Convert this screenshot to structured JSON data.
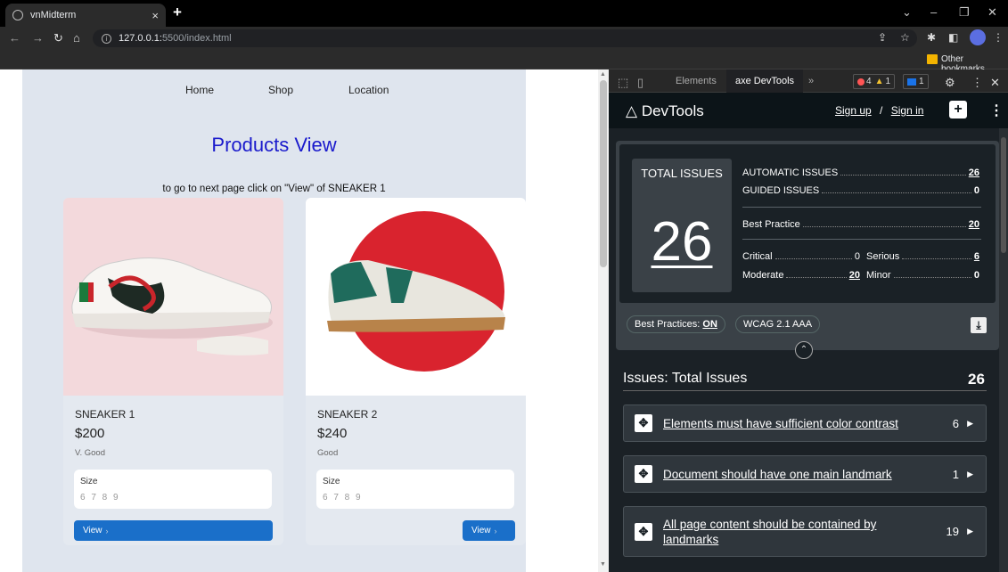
{
  "browser": {
    "tab_title": "vnMidterm",
    "tab_close": "×",
    "new_tab": "+",
    "url_host": "127.0.0.1:",
    "url_path": "5500/index.html",
    "bookmarks_other": "Other bookmarks"
  },
  "page": {
    "nav": [
      "Home",
      "Shop",
      "Location"
    ],
    "title": "Products View",
    "hint": "to go to next page click on \"View\" of SNEAKER 1",
    "products": [
      {
        "name": "SNEAKER 1",
        "price": "$200",
        "condition": "V. Good",
        "size_label": "Size",
        "sizes": "6 7 8 9",
        "button": "View"
      },
      {
        "name": "SNEAKER 2",
        "price": "$240",
        "condition": "Good",
        "size_label": "Size",
        "sizes": "6 7 8 9",
        "button": "View"
      }
    ]
  },
  "devtools": {
    "tabs": {
      "elements": "Elements",
      "axe": "axe DevTools",
      "more": "»"
    },
    "badges": {
      "errors": "4",
      "warnings": "1",
      "messages": "1"
    },
    "header": {
      "logo": "DevTools",
      "sign_up": "Sign up",
      "separator": "/",
      "sign_in": "Sign in"
    },
    "summary": {
      "total_label": "TOTAL ISSUES",
      "total_value": "26",
      "automatic_label": "AUTOMATIC ISSUES",
      "automatic_value": "26",
      "guided_label": "GUIDED ISSUES",
      "guided_value": "0",
      "best_practice_label": "Best Practice",
      "best_practice_value": "20",
      "critical_label": "Critical",
      "critical_value": "0",
      "serious_label": "Serious",
      "serious_value": "6",
      "moderate_label": "Moderate",
      "moderate_value": "20",
      "minor_label": "Minor",
      "minor_value": "0",
      "best_practices_toggle": "Best Practices:",
      "best_practices_state": "ON",
      "standard": "WCAG 2.1 AAA"
    },
    "issues": {
      "heading": "Issues: Total Issues",
      "count": "26",
      "items": [
        {
          "text": "Elements must have sufficient color contrast",
          "count": "6"
        },
        {
          "text": "Document should have one main landmark",
          "count": "1"
        },
        {
          "text": "All page content should be contained by landmarks",
          "count": "19"
        }
      ]
    }
  },
  "colors": {
    "accent": "#1a6fc9",
    "title_blue": "#1a1acc",
    "axe_bg": "#1b2126"
  }
}
